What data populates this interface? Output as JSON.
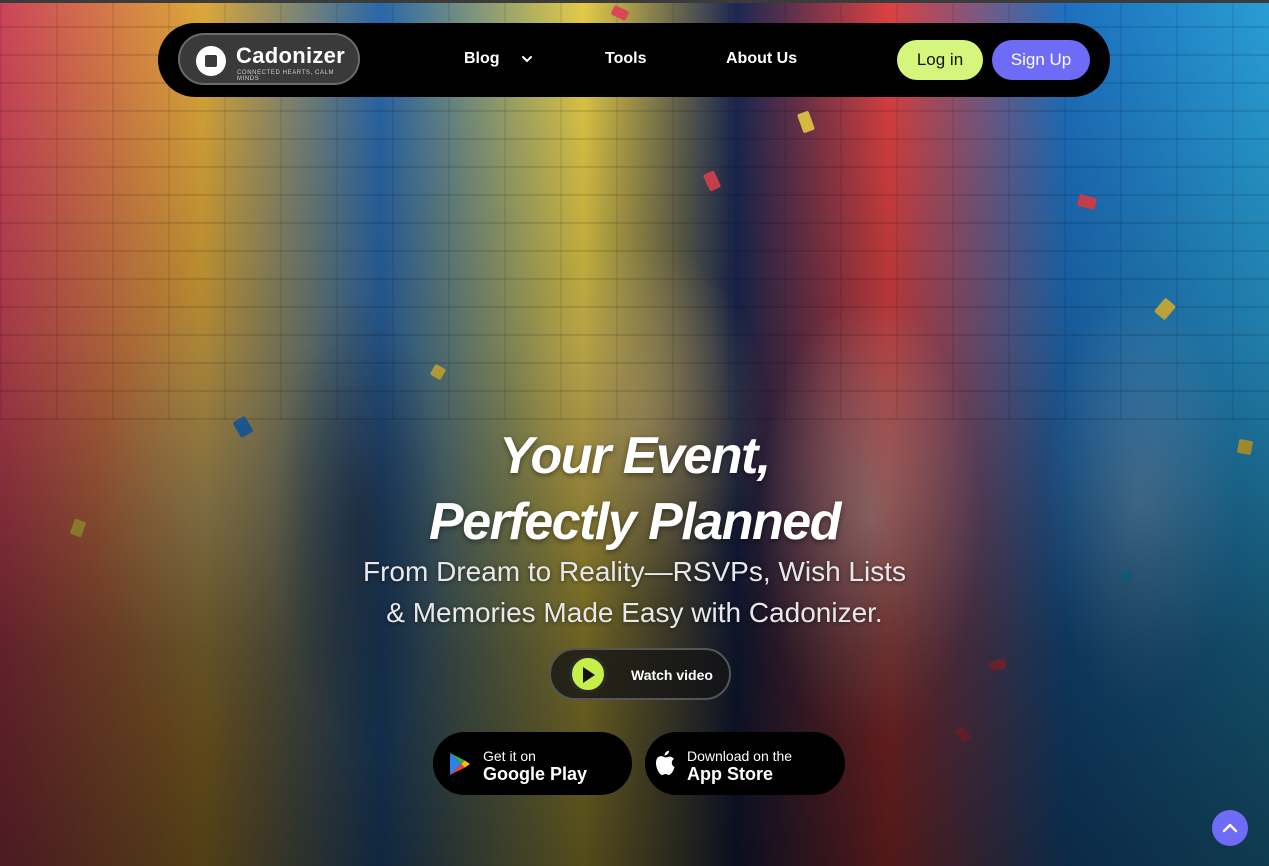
{
  "brand": {
    "name": "Cadonizer",
    "tagline": "CONNECTED HEARTS, CALM MINDS"
  },
  "nav": {
    "items": [
      {
        "label": "Blog",
        "has_dropdown": true
      },
      {
        "label": "Tools"
      },
      {
        "label": "About Us"
      }
    ],
    "login_label": "Log in",
    "signup_label": "Sign Up"
  },
  "hero": {
    "headline_line1": "Your Event,",
    "headline_line2": "Perfectly Planned",
    "subtitle_line1": "From Dream to Reality—RSVPs, Wish Lists",
    "subtitle_line2": "& Memories Made Easy with Cadonizer.",
    "watch_video_label": "Watch video"
  },
  "stores": {
    "google": {
      "line1": "Get it on",
      "line2": "Google Play",
      "icon": "google-play-icon"
    },
    "apple": {
      "line1": "Download on the",
      "line2": "App Store",
      "icon": "apple-icon"
    }
  },
  "colors": {
    "login_bg": "#d6f57c",
    "signup_bg": "#6e6cf7",
    "play_bg": "#c6ef4a",
    "scroll_top_bg": "#6e6cf7"
  }
}
